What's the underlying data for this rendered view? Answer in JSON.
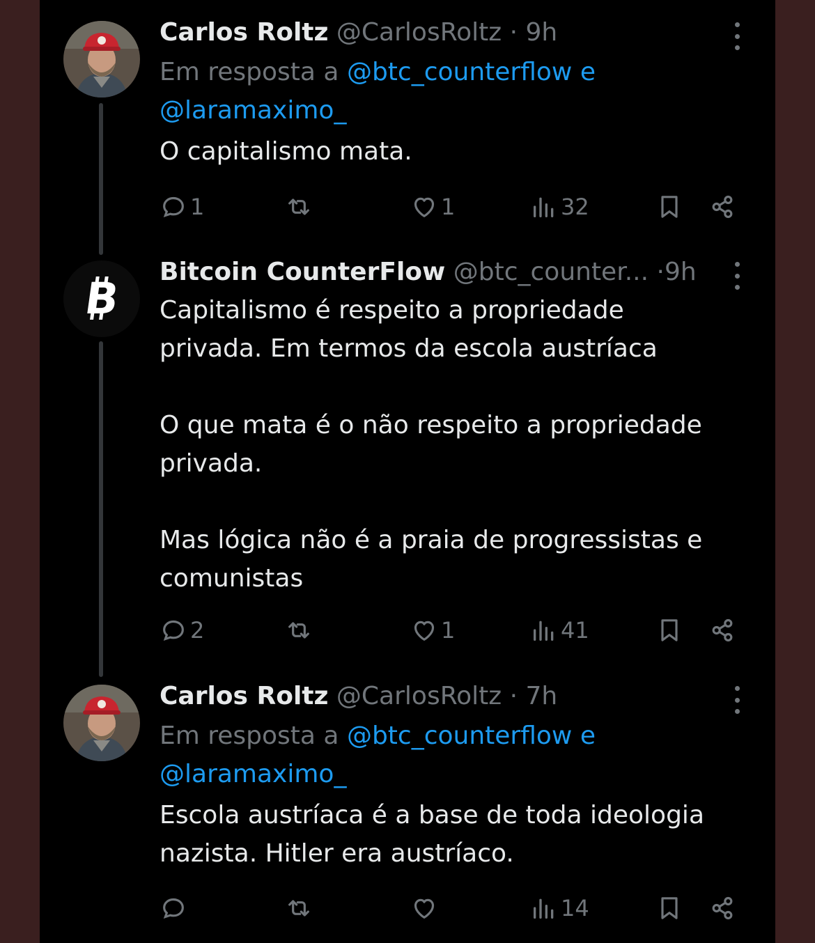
{
  "tweets": [
    {
      "name": "Carlos Roltz",
      "handle": "@CarlosRoltz",
      "dot": "·",
      "time": "9h",
      "reply_prefix": "Em resposta a",
      "mention1": "@btc_counterflow",
      "conj": "e",
      "mention2": "@laramaximo_",
      "text": "O capitalismo mata.",
      "replies": "1",
      "likes": "1",
      "views": "32"
    },
    {
      "name": "Bitcoin CounterFlow",
      "handle": "@btc_counter...",
      "dot": "·",
      "time": "9h",
      "text": "Capitalismo é respeito a propriedade\nprivada. Em termos da escola austríaca\n\nO que mata é o não respeito a propriedade\nprivada.\n\nMas lógica não é a praia de progressistas e\ncomunistas",
      "replies": "2",
      "likes": "1",
      "views": "41"
    },
    {
      "name": "Carlos Roltz",
      "handle": "@CarlosRoltz",
      "dot": "·",
      "time": "7h",
      "reply_prefix": "Em resposta a",
      "mention1": "@btc_counterflow",
      "conj": "e",
      "mention2": "@laramaximo_",
      "text": "Escola austríaca é a base de toda ideologia\nnazista. Hitler era austríaco.",
      "replies": "",
      "likes": "",
      "views": "14"
    }
  ],
  "colors": {
    "background": "#000000",
    "outer": "#3a1f1f",
    "text": "#e7e9ea",
    "muted": "#71767b",
    "link": "#1d9bf0"
  },
  "icons": [
    "more-icon",
    "reply-icon",
    "retweet-icon",
    "like-icon",
    "views-icon",
    "bookmark-icon",
    "share-icon",
    "bitcoin-logo",
    "avatar"
  ]
}
